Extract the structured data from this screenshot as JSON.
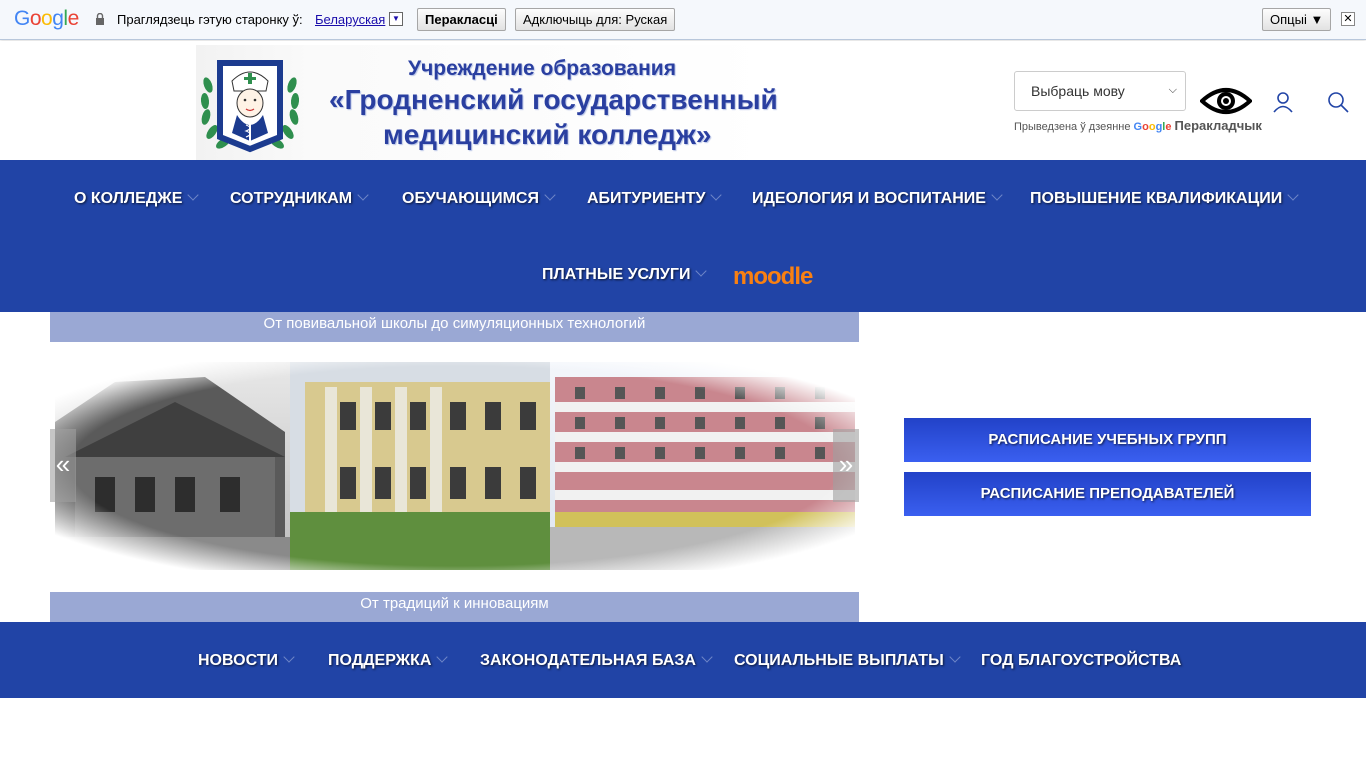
{
  "translate_bar": {
    "logo": "Google",
    "prompt": "Праглядзець гэтую старонку ў:",
    "language_link": "Беларуская",
    "translate_button": "Перакласці",
    "always_button": "Адключыць для: Руская",
    "options_button": "Опцыі ▼",
    "close_symbol": "✕"
  },
  "header": {
    "inst_line1": "Учреждение образования",
    "inst_line2": "«Гродненский государственный",
    "inst_line3": "медицинский колледж»",
    "language_select": "Выбраць мову",
    "powered_prefix": "Прыведзена ў дзеянне",
    "powered_google": "Google",
    "powered_suffix": "Перакладчык"
  },
  "main_nav": {
    "items": [
      {
        "label": "О колледже"
      },
      {
        "label": "Сотрудникам"
      },
      {
        "label": "Обучающимся"
      },
      {
        "label": "Абитуриенту"
      },
      {
        "label": "Идеология и воспитание"
      },
      {
        "label": "Повышение квалификации"
      },
      {
        "label": "Платные услуги"
      }
    ],
    "moodle_label": "moodle"
  },
  "slider": {
    "caption_top": "От повивальной школы до симуляционных технологий",
    "caption_bottom": "От традиций к инновациям",
    "prev": "«",
    "next": "»"
  },
  "schedule": {
    "groups_label": "Расписание учебных групп",
    "teachers_label": "Расписание преподавателей"
  },
  "bottom_nav": {
    "items": [
      {
        "label": "Новости"
      },
      {
        "label": "Поддержка"
      },
      {
        "label": "Законодательная база"
      },
      {
        "label": "Социальные выплаты"
      },
      {
        "label": "Год благоустройства"
      }
    ]
  },
  "colors": {
    "nav_blue": "#2144a6",
    "caption_bg": "#9aa8d4",
    "button_blue": "#2a4fe0",
    "title_blue": "#2a3fa0",
    "moodle_orange": "#f98012"
  }
}
